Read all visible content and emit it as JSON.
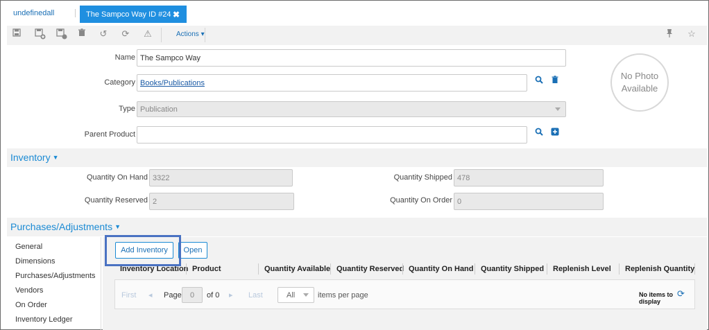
{
  "tabs": {
    "home_label": "undefinedall",
    "active_label": "The Sampco Way ID #24"
  },
  "toolbar": {
    "actions_label": "Actions"
  },
  "form": {
    "name_label": "Name",
    "name_value": "The Sampco Way",
    "category_label": "Category",
    "category_value": "Books/Publications",
    "type_label": "Type",
    "type_value": "Publication",
    "parent_label": "Parent Product",
    "parent_value": ""
  },
  "photo": {
    "line1": "No Photo",
    "line2": "Available"
  },
  "inventory": {
    "title": "Inventory",
    "qoh_label": "Quantity On Hand",
    "qoh_value": "3322",
    "qshipped_label": "Quantity Shipped",
    "qshipped_value": "478",
    "qreserved_label": "Quantity Reserved",
    "qreserved_value": "2",
    "qorder_label": "Quantity On Order",
    "qorder_value": "0"
  },
  "purchases": {
    "title": "Purchases/Adjustments",
    "nav": [
      "General",
      "Dimensions",
      "Purchases/Adjustments",
      "Vendors",
      "On Order",
      "Inventory Ledger"
    ],
    "add_button": "Add Inventory",
    "open_button": "Open",
    "columns": [
      "Inventory Location",
      "Product",
      "Quantity Available",
      "Quantity Reserved",
      "Quantity On Hand",
      "Quantity Shipped",
      "Replenish Level",
      "Replenish Quantity"
    ],
    "pager": {
      "first": "First",
      "page_label": "Page",
      "page_value": "0",
      "of_label": "of 0",
      "last": "Last",
      "per_page_value": "All",
      "per_page_label": "items per page",
      "empty_text": "No items to display"
    }
  }
}
